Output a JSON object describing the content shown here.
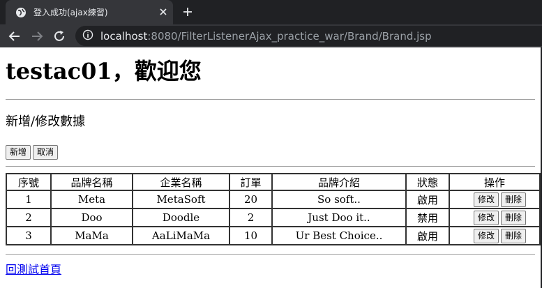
{
  "browser": {
    "tab_title": "登入成功(ajax練習)",
    "url_host": "localhost",
    "url_rest": ":8080/FilterListenerAjax_practice_war/Brand/Brand.jsp"
  },
  "page": {
    "welcome": "testac01，歡迎您",
    "section_title": "新增/修改數據",
    "add_button": "新增",
    "cancel_button": "取消",
    "back_link": "回測試首頁"
  },
  "table": {
    "headers": [
      "序號",
      "品牌名稱",
      "企業名稱",
      "訂單",
      "品牌介紹",
      "狀態",
      "操作"
    ],
    "rows": [
      {
        "id": "1",
        "brand": "Meta",
        "company": "MetaSoft",
        "orders": "20",
        "intro": "So soft..",
        "status": "啟用",
        "edit": "修改",
        "delete": "刪除"
      },
      {
        "id": "2",
        "brand": "Doo",
        "company": "Doodle",
        "orders": "2",
        "intro": "Just Doo it..",
        "status": "禁用",
        "edit": "修改",
        "delete": "刪除"
      },
      {
        "id": "3",
        "brand": "MaMa",
        "company": "AaLiMaMa",
        "orders": "10",
        "intro": "Ur Best Choice..",
        "status": "啟用",
        "edit": "修改",
        "delete": "刪除"
      }
    ]
  }
}
